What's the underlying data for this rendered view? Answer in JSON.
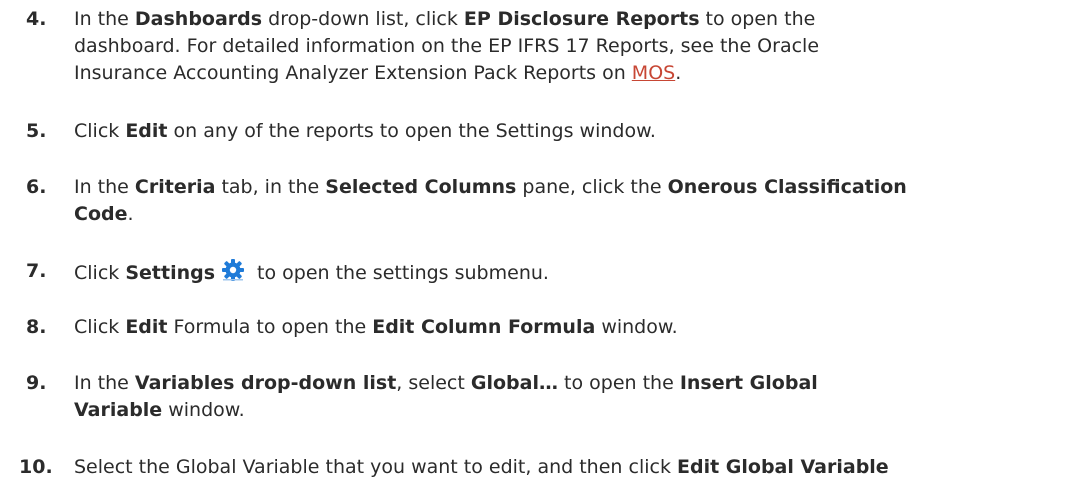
{
  "steps": [
    {
      "number": "4.",
      "line1_pre": "In the ",
      "line1_b1": "Dashboards",
      "line1_mid": " drop-down list, click ",
      "line1_b2": "EP Disclosure Reports",
      "line1_post": " to open the",
      "line2": "dashboard. For detailed information on the EP IFRS 17 Reports, see the Oracle",
      "line3_pre": "Insurance Accounting Analyzer Extension Pack Reports on ",
      "line3_link": "MOS",
      "line3_post": "."
    },
    {
      "number": "5.",
      "pre": "Click ",
      "b1": "Edit",
      "post": " on any of the reports to open the Settings window."
    },
    {
      "number": "6.",
      "line1_pre": "In the ",
      "line1_b1": "Criteria",
      "line1_mid1": " tab, in the ",
      "line1_b2": "Selected Columns",
      "line1_mid2": " pane, click the ",
      "line1_b3": "Onerous Classification",
      "line2_b": "Code",
      "line2_post": "."
    },
    {
      "number": "7.",
      "pre": "Click ",
      "b1": "Settings",
      "icon": "gear-icon",
      "post": "to open the settings submenu."
    },
    {
      "number": "8.",
      "pre": "Click ",
      "b1": "Edit",
      "mid": " Formula to open the ",
      "b2": "Edit Column Formula",
      "post": " window."
    },
    {
      "number": "9.",
      "line1_pre": "In the ",
      "line1_b1": "Variables drop-down list",
      "line1_mid": ", select ",
      "line1_b2": "Global…",
      "line1_mid2": " to open the ",
      "line1_b3": "Insert Global",
      "line2_b": "Variable",
      "line2_post": " window."
    },
    {
      "number": "10.",
      "pre": "Select the Global Variable that you want to edit, and then click ",
      "b1": "Edit Global Variable"
    }
  ],
  "colors": {
    "text": "#2b2b2b",
    "link": "#c74634",
    "gear": "#1f7bd8"
  }
}
